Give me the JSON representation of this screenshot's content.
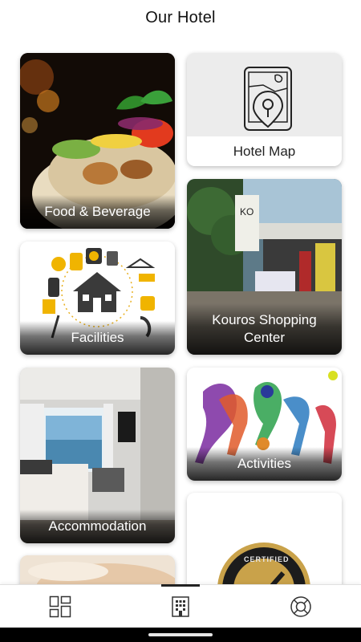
{
  "header": {
    "title": "Our Hotel"
  },
  "cards": {
    "food": {
      "label": "Food & Beverage"
    },
    "map": {
      "label": "Hotel Map"
    },
    "facilities": {
      "label": "Facilities"
    },
    "kouros": {
      "label": "Kouros Shopping Center"
    },
    "accommodation": {
      "label": "Accommodation"
    },
    "activities": {
      "label": "Activities"
    },
    "certified": {
      "badge_text": "CERTIFIED"
    }
  },
  "bottom_nav": {
    "items": [
      {
        "name": "dashboard",
        "icon": "grid-layout-icon",
        "active": false
      },
      {
        "name": "hotel",
        "icon": "building-icon",
        "active": true
      },
      {
        "name": "support",
        "icon": "lifebuoy-icon",
        "active": false
      }
    ]
  },
  "colors": {
    "accent": "#222222",
    "card_label": "#ffffff"
  }
}
